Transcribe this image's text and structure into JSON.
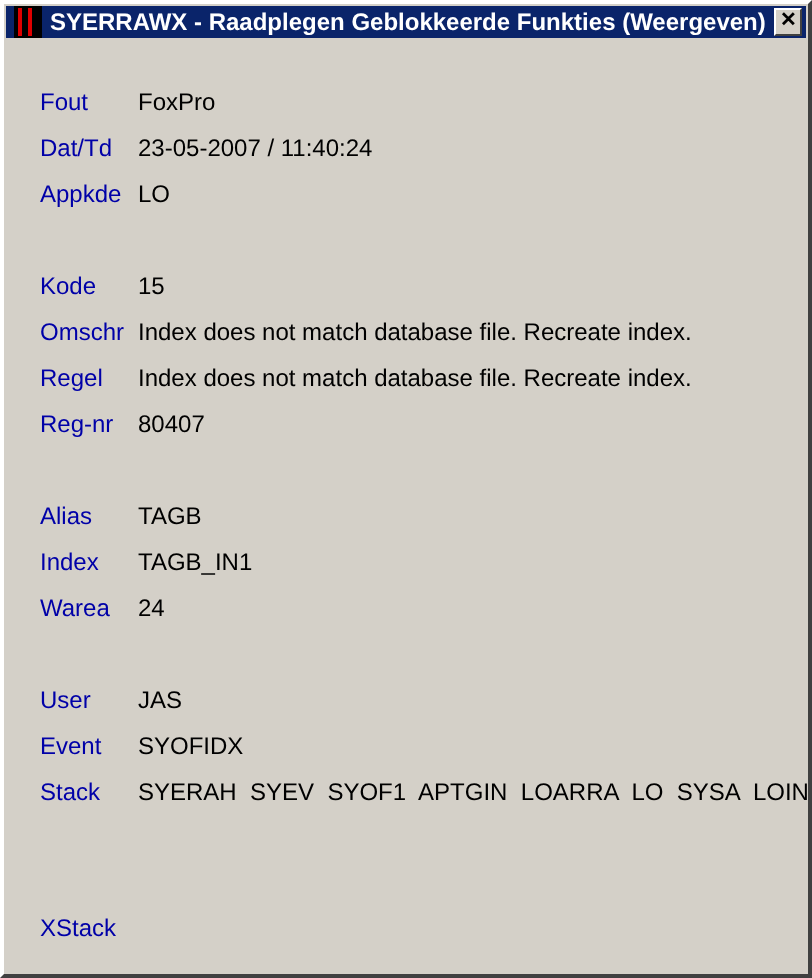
{
  "window": {
    "title": "SYERRAWX - Raadplegen Geblokkeerde Funkties (Weergeven)",
    "close": "✕"
  },
  "groups": [
    {
      "fields": [
        {
          "label": "Fout",
          "value": "FoxPro"
        },
        {
          "label": "Dat/Td",
          "value": "23-05-2007 / 11:40:24"
        },
        {
          "label": "Appkde",
          "value": "LO"
        }
      ]
    },
    {
      "fields": [
        {
          "label": "Kode",
          "value": "15"
        },
        {
          "label": "Omschr",
          "value": "Index does not match database file. Recreate index."
        },
        {
          "label": "Regel",
          "value": "Index does not match database file. Recreate index."
        },
        {
          "label": "Reg-nr",
          "value": "80407"
        }
      ]
    },
    {
      "fields": [
        {
          "label": "Alias",
          "value": "TAGB"
        },
        {
          "label": "Index",
          "value": "TAGB_IN1"
        },
        {
          "label": "Warea",
          "value": "24"
        }
      ]
    },
    {
      "fields": [
        {
          "label": "User",
          "value": "JAS"
        },
        {
          "label": "Event",
          "value": "SYOFIDX"
        },
        {
          "label": "Stack",
          "value": "SYERAH  SYEV  SYOF1  APTGIN  LOARRA  LO  SYSA  LOIN"
        }
      ]
    },
    {
      "fields": [
        {
          "label": "XStack"
        }
      ]
    }
  ]
}
